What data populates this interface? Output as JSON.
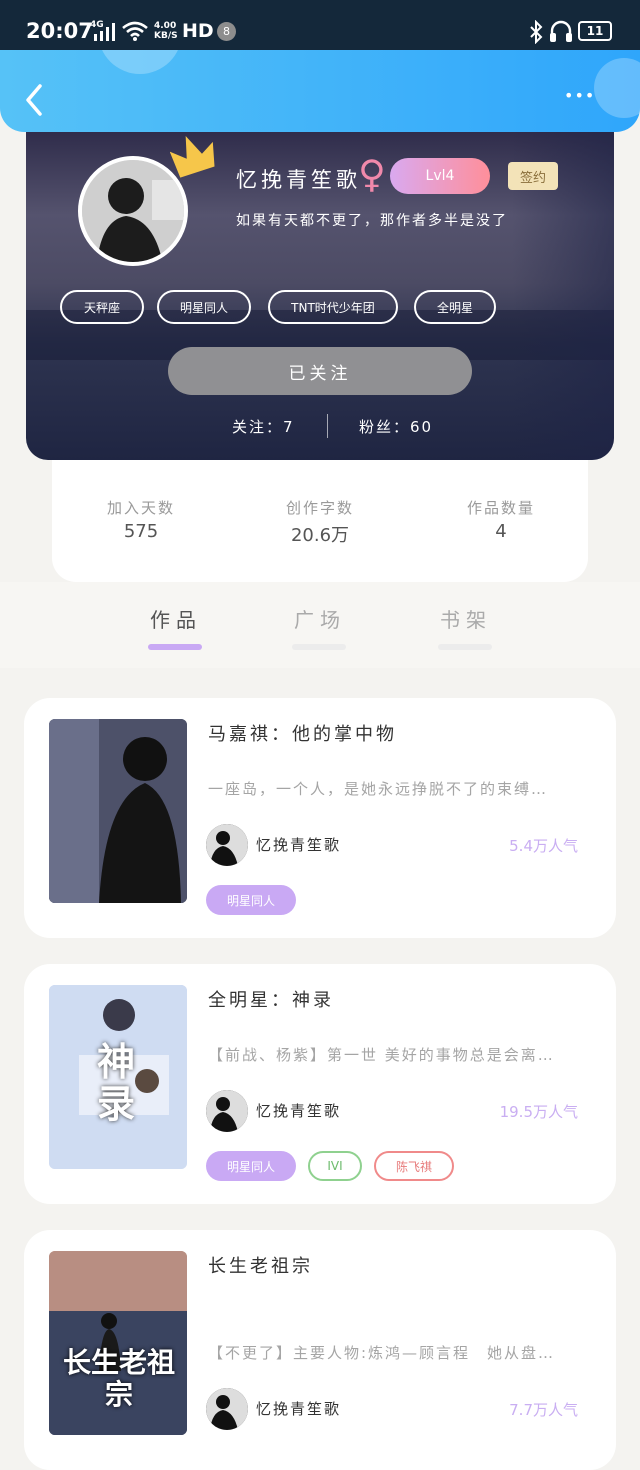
{
  "status_bar": {
    "time": "20:07",
    "network": "4G",
    "speed_value": "4.00",
    "speed_unit": "KB/S",
    "hd": "HD",
    "notif_count": "8",
    "battery": "11"
  },
  "header": {
    "more": "•••"
  },
  "profile": {
    "name": "忆挽青笙歌",
    "gender_symbol": "♀",
    "level": "Lvl4",
    "badge": "签约",
    "signature": "如果有天都不更了，那作者多半是没了",
    "tags": [
      "天秤座",
      "明星同人",
      "TNT时代少年团",
      "全明星"
    ],
    "follow_button": "已关注",
    "following": "关注：7",
    "fans": "粉丝：60"
  },
  "stats": [
    {
      "label": "加入天数",
      "value": "575"
    },
    {
      "label": "创作字数",
      "value": "20.6万"
    },
    {
      "label": "作品数量",
      "value": "4"
    }
  ],
  "tabs": [
    "作品",
    "广场",
    "书架"
  ],
  "active_tab": 0,
  "colors": {
    "accent": "#c9a9f4",
    "header_blue": "#39aefa",
    "pink": "#ff8aa0"
  },
  "books": [
    {
      "title": "马嘉祺：他的掌中物",
      "desc": "一座岛，一个人，是她永远挣脱不了的束缚…",
      "author": "忆挽青笙歌",
      "popularity": "5.4万人气",
      "tags": [
        {
          "label": "明星同人",
          "style": "filled"
        }
      ]
    },
    {
      "title": "全明星：神录",
      "desc": "【前战、杨紫】第一世 美好的事物总是会离…",
      "author": "忆挽青笙歌",
      "popularity": "19.5万人气",
      "cover_text": "神录",
      "tags": [
        {
          "label": "明星同人",
          "style": "filled"
        },
        {
          "label": "IVI",
          "style": "green"
        },
        {
          "label": "陈飞祺",
          "style": "red"
        }
      ]
    },
    {
      "title": "长生老祖宗",
      "desc": "【不更了】主要人物:炼鸿—顾言程　她从盘…",
      "author": "忆挽青笙歌",
      "popularity": "7.7万人气",
      "cover_text": "长生老祖宗",
      "tags": []
    }
  ]
}
